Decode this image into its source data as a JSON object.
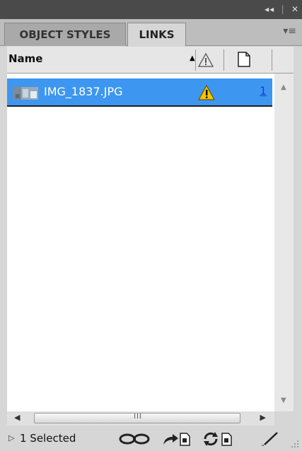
{
  "titlebar": {
    "collapse_glyph": "◂◂",
    "close_glyph": "✕"
  },
  "tabs": [
    {
      "label": "OBJECT STYLES",
      "active": false
    },
    {
      "label": "LINKS",
      "active": true
    }
  ],
  "panel_menu_glyph": "▾≡",
  "columns": {
    "name": "Name",
    "sort_indicator": "▲"
  },
  "links": [
    {
      "name": "IMG_1837.JPG",
      "status": "warning",
      "page": "1",
      "selected": true
    }
  ],
  "scroll": {
    "grip": "III"
  },
  "footer": {
    "selection": "1 Selected"
  },
  "colors": {
    "selection": "#3d97f0",
    "warning": "#f5c400",
    "page_link": "#1a3fd1"
  }
}
